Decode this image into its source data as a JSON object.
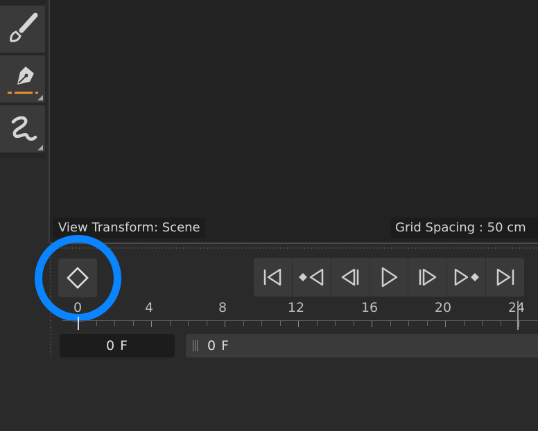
{
  "toolbar": {
    "tools": [
      {
        "name": "brush-tool",
        "icon": "brush-icon"
      },
      {
        "name": "pen-tool",
        "icon": "pen-nib-icon",
        "accent": "#e8912d"
      },
      {
        "name": "stroke-tool",
        "icon": "squiggle-icon"
      }
    ]
  },
  "viewport": {
    "view_transform_label": "View Transform: Scene",
    "grid_spacing_label": "Grid Spacing : 50 cm"
  },
  "timeline": {
    "keyframe_button_icon": "diamond-outline-icon",
    "highlight_color": "#0a84ff",
    "playback_buttons": [
      {
        "name": "go-to-start-button",
        "icon": "skip-to-start-icon"
      },
      {
        "name": "previous-keyframe-button",
        "icon": "previous-keyframe-icon"
      },
      {
        "name": "step-back-button",
        "icon": "step-back-icon"
      },
      {
        "name": "play-button",
        "icon": "play-icon"
      },
      {
        "name": "step-forward-button",
        "icon": "step-forward-icon"
      },
      {
        "name": "next-keyframe-button",
        "icon": "next-keyframe-icon"
      },
      {
        "name": "go-to-end-button",
        "icon": "skip-to-end-icon"
      }
    ],
    "ruler_labels": [
      "0",
      "4",
      "8",
      "12",
      "16",
      "20",
      "24"
    ],
    "current_frame": "0 F",
    "frame_bar_value": "0 F"
  }
}
